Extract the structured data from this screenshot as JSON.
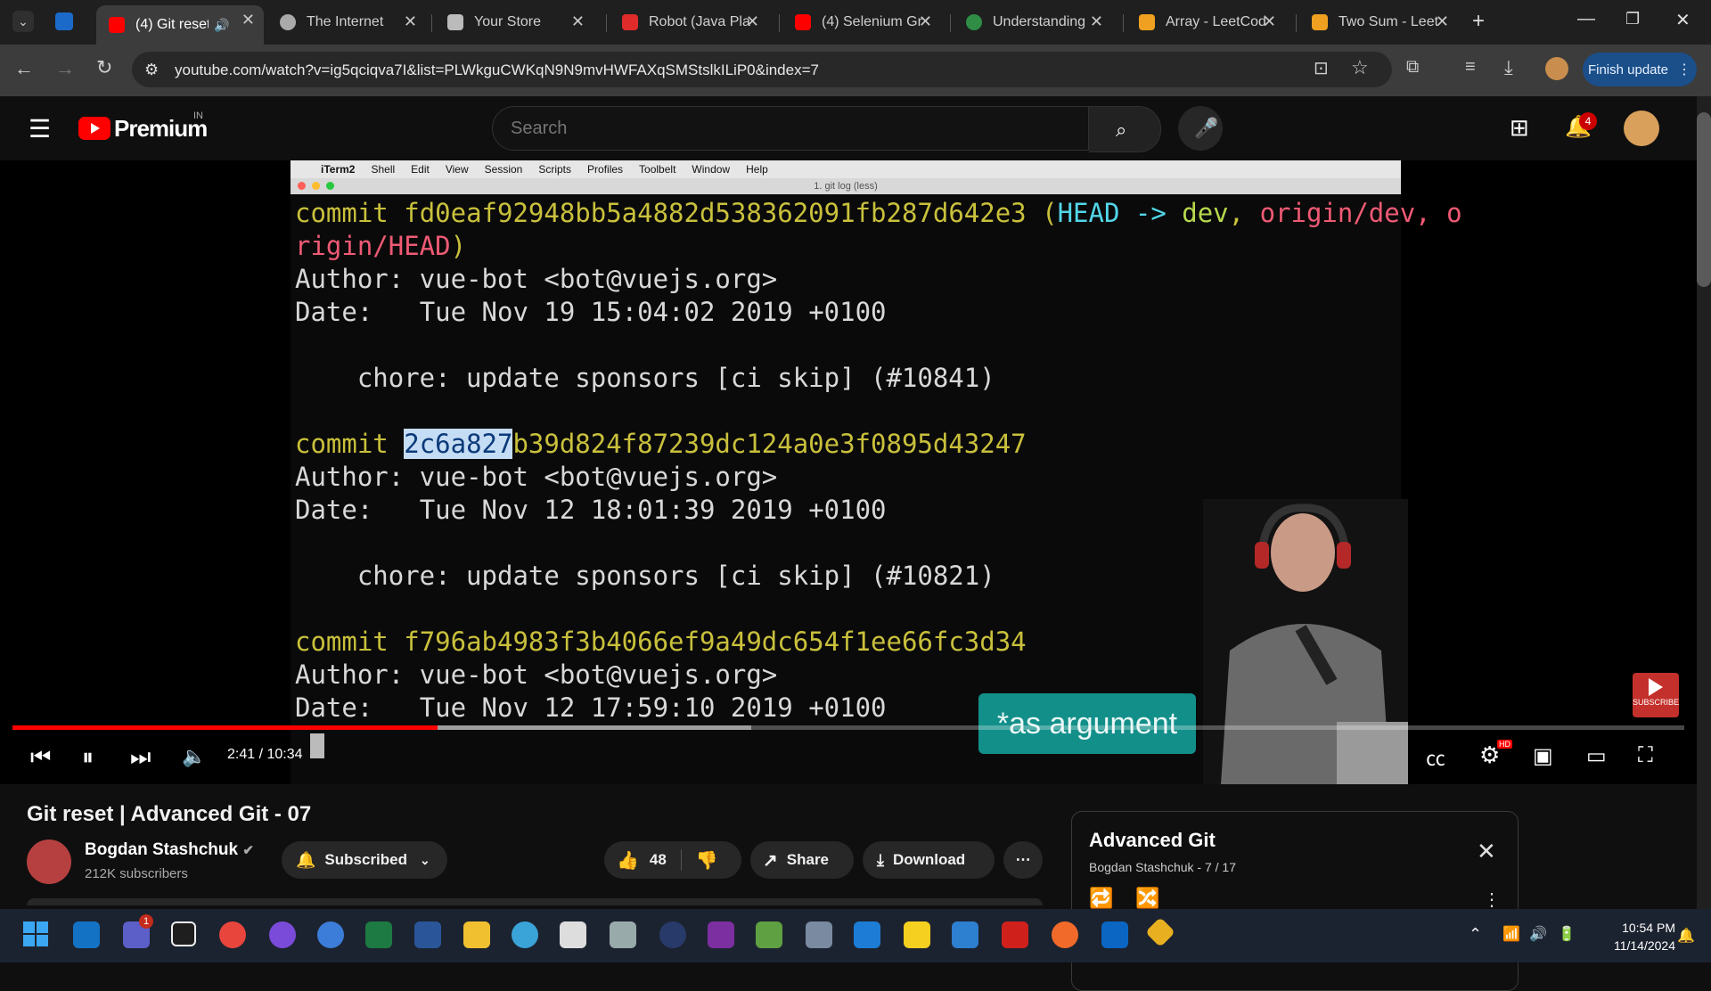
{
  "browser": {
    "tabs": [
      {
        "label": "(4) Git reset",
        "active": true
      },
      {
        "label": "The Internet"
      },
      {
        "label": "Your Store"
      },
      {
        "label": "Robot (Java Pla"
      },
      {
        "label": "(4) Selenium Gr"
      },
      {
        "label": "Understanding"
      },
      {
        "label": "Array - LeetCod"
      },
      {
        "label": "Two Sum - Leet"
      }
    ],
    "url": "youtube.com/watch?v=ig5qciqva7I&list=PLWkguCWKqN9N9mvHWFAXqSMStslkILiP0&index=7",
    "finish_update_label": "Finish update",
    "accent": "#1a4f8a"
  },
  "youtube": {
    "logo": "Premium",
    "logo_region": "IN",
    "search_placeholder": "Search",
    "notification_count": "4"
  },
  "terminal": {
    "menubar": [
      "iTerm2",
      "Shell",
      "Edit",
      "View",
      "Session",
      "Scripts",
      "Profiles",
      "Toolbelt",
      "Window",
      "Help"
    ],
    "title": "1. git log (less)",
    "commit1_hash": "fd0eaf92948bb5a4882d538362091fb287d642e3",
    "commit1_refs_head": "HEAD -> ",
    "commit1_refs_dev": "dev",
    "commit1_refs_origin": "origin/dev, o",
    "commit1_refs_origin2": "rigin/HEAD",
    "author": "vue-bot <bot@vuejs.org>",
    "date1": "Tue Nov 19 15:04:02 2019 +0100",
    "msg1": "chore: update sponsors [ci skip] (#10841)",
    "commit2_sel": "2c6a827",
    "commit2_rest": "b39d824f87239dc124a0e3f0895d43247",
    "date2": "Tue Nov 12 18:01:39 2019 +0100",
    "msg2": "chore: update sponsors [ci skip] (#10821)",
    "commit3_hash": "f796ab4983f3b4066ef9a49dc654f1ee66fc3d34",
    "date3": "Tue Nov 12 17:59:10 2019 +0100",
    "word_commit": "commit",
    "word_author": "Author:",
    "word_date": "Date:"
  },
  "player": {
    "caption": "*as argument",
    "time": "2:41 / 10:34",
    "progress": 0.254,
    "buffered": 0.442,
    "subscribe_label": "SUBSCRIBE",
    "hd_badge": "HD"
  },
  "video": {
    "title": "Git reset | Advanced Git - 07",
    "channel": "Bogdan Stashchuk",
    "subscribers": "212K subscribers",
    "subscribed_label": "Subscribed",
    "likes": "48",
    "share_label": "Share",
    "download_label": "Download"
  },
  "playlist": {
    "title": "Advanced Git",
    "subtitle": "Bogdan Stashchuk - 7 / 17"
  },
  "taskbar": {
    "time": "10:54 PM",
    "date": "11/14/2024",
    "teams_badge": "1"
  }
}
